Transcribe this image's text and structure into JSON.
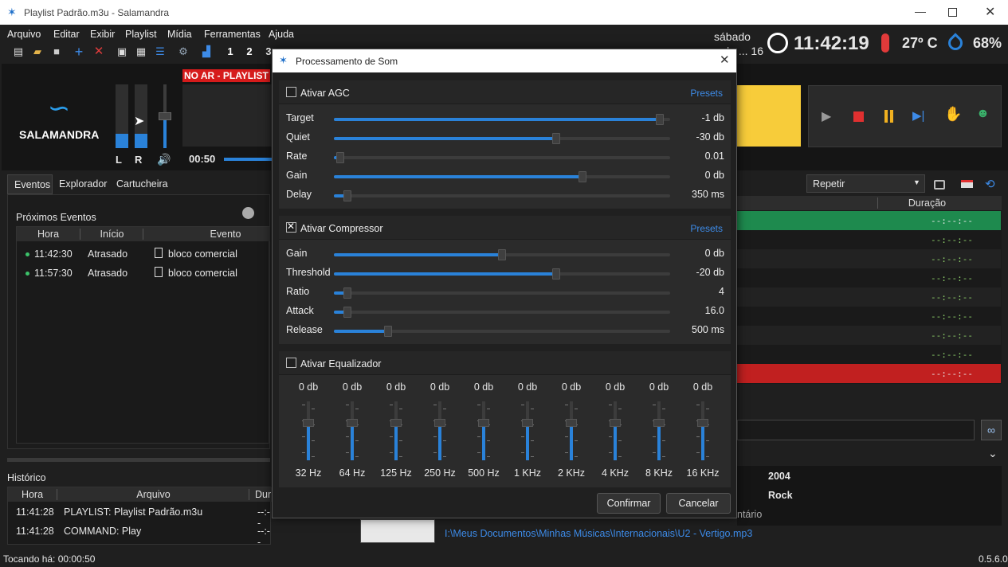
{
  "window": {
    "title": "Playlist Padrão.m3u - Salamandra"
  },
  "menu": [
    "Arquivo",
    "Editar",
    "Exibir",
    "Playlist",
    "Mídia",
    "Ferramentas",
    "Ajuda"
  ],
  "toolbar": {
    "numbers": [
      "1",
      "2",
      "3"
    ]
  },
  "clock": {
    "day": "sábado",
    "date": "16 de ... 2024",
    "time": "11:42:19",
    "temp": "27º C",
    "humidity": "68%"
  },
  "player": {
    "logo_text": "SALAMANDRA",
    "onair": "NO AR - PLAYLIST",
    "left": "L",
    "right": "R",
    "elapsed": "00:50",
    "level_l": 0.22,
    "level_r": 0.22,
    "volume": 0.5
  },
  "tabs": [
    "Eventos",
    "Explorador",
    "Cartucheira"
  ],
  "events": {
    "title": "Próximos Eventos",
    "cols": [
      "Hora",
      "Início",
      "Evento"
    ],
    "rows": [
      {
        "time": "11:42:30",
        "start": "Atrasado",
        "event": "bloco comercial"
      },
      {
        "time": "11:57:30",
        "start": "Atrasado",
        "event": "bloco comercial"
      }
    ]
  },
  "history": {
    "title": "Histórico",
    "cols": [
      "Hora",
      "Arquivo",
      "Dur"
    ],
    "rows": [
      {
        "time": "11:41:28",
        "file": "PLAYLIST: Playlist Padrão.m3u",
        "dur": "--:--"
      },
      {
        "time": "11:41:28",
        "file": "COMMAND: Play",
        "dur": "--:--"
      }
    ]
  },
  "playlist": {
    "mode": "Repetir",
    "col_dur": "Duração",
    "durations": [
      "--:--:--",
      "--:--:--",
      "--:--:--",
      "--:--:--",
      "--:--:--",
      "--:--:--",
      "--:--:--",
      "--:--:--",
      "--:--:--"
    ]
  },
  "details": {
    "year": "2004",
    "genre": "Rock",
    "comment_label": "ntário",
    "path": "I:\\Meus Documentos\\Minhas Músicas\\Internacionais\\U2 - Vertigo.mp3"
  },
  "status": {
    "playing": "Tocando há: 00:00:50",
    "version": "0.5.6.0"
  },
  "dialog": {
    "title": "Processamento de Som",
    "agc": {
      "label": "Ativar AGC",
      "checked": false,
      "presets": "Presets",
      "rows": [
        {
          "name": "Target",
          "value": "-1 db",
          "level": 0.97
        },
        {
          "name": "Quiet",
          "value": "-30 db",
          "level": 0.66
        },
        {
          "name": "Rate",
          "value": "0.01",
          "level": 0.02
        },
        {
          "name": "Gain",
          "value": "0 db",
          "level": 0.74
        },
        {
          "name": "Delay",
          "value": "350 ms",
          "level": 0.04
        }
      ]
    },
    "comp": {
      "label": "Ativar Compressor",
      "checked": true,
      "presets": "Presets",
      "rows": [
        {
          "name": "Gain",
          "value": "0 db",
          "level": 0.5
        },
        {
          "name": "Threshold",
          "value": "-20 db",
          "level": 0.66
        },
        {
          "name": "Ratio",
          "value": "4",
          "level": 0.04
        },
        {
          "name": "Attack",
          "value": "16.0",
          "level": 0.04
        },
        {
          "name": "Release",
          "value": "500 ms",
          "level": 0.16
        }
      ]
    },
    "eq": {
      "label": "Ativar Equalizador",
      "checked": false,
      "bands": [
        {
          "freq": "32 Hz",
          "value": "0 db"
        },
        {
          "freq": "64 Hz",
          "value": "0 db"
        },
        {
          "freq": "125 Hz",
          "value": "0 db"
        },
        {
          "freq": "250 Hz",
          "value": "0 db"
        },
        {
          "freq": "500 Hz",
          "value": "0 db"
        },
        {
          "freq": "1 KHz",
          "value": "0 db"
        },
        {
          "freq": "2 KHz",
          "value": "0 db"
        },
        {
          "freq": "4 KHz",
          "value": "0 db"
        },
        {
          "freq": "8 KHz",
          "value": "0 db"
        },
        {
          "freq": "16 KHz",
          "value": "0 db"
        }
      ]
    },
    "confirm": "Confirmar",
    "cancel": "Cancelar"
  },
  "colors": {
    "accent": "#2a82d9",
    "playing_row": "#1e8a4e",
    "error_row": "#c12020",
    "time_green": "#8fd36b",
    "gauge_yellow": "#f7cc3a"
  }
}
